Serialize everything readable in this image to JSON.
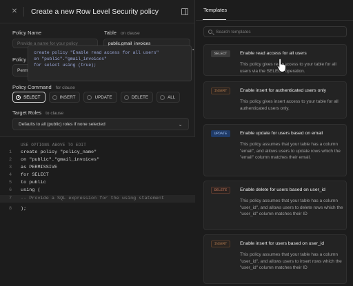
{
  "editor_panel": {
    "title": "Create a new Row Level Security policy",
    "policy_name_label": "Policy Name",
    "policy_name_placeholder": "Provide a name for your policy",
    "table_label": "Table",
    "table_sublabel": "on clause",
    "table_value": "public.gmail_invoices",
    "policy_behavior_label": "Policy B",
    "policy_behavior_value": "Perm",
    "tooltip_lines": [
      "create policy \"Enable read access for all users\"",
      "on \"public\".\"gmail_invoices\"",
      "for select using (true);"
    ],
    "policy_command_label": "Policy Command",
    "policy_command_sublabel": "for clause",
    "commands": [
      "SELECT",
      "INSERT",
      "UPDATE",
      "DELETE",
      "ALL"
    ],
    "selected_command": "SELECT",
    "target_roles_label": "Target Roles",
    "target_roles_sublabel": "to clause",
    "target_roles_value": "Defaults to all (public) roles if none selected",
    "code_lines": [
      {
        "n": "",
        "text": "USE OPTIONS ABOVE TO EDIT",
        "type": "comment"
      },
      {
        "n": "1",
        "text": "create policy \"policy_name\"",
        "type": "code"
      },
      {
        "n": "2",
        "text": "on \"public\".\"gmail_invoices\"",
        "type": "code"
      },
      {
        "n": "3",
        "text": "as PERMISSIVE",
        "type": "code"
      },
      {
        "n": "4",
        "text": "for SELECT",
        "type": "code"
      },
      {
        "n": "5",
        "text": "to public",
        "type": "code"
      },
      {
        "n": "6",
        "text": "using (",
        "type": "code"
      },
      {
        "n": "7",
        "text": "-- Provide a SQL expression for the using statement",
        "type": "comment"
      },
      {
        "n": "8",
        "text": ");",
        "type": "code"
      }
    ]
  },
  "templates_panel": {
    "tab_label": "Templates",
    "search_placeholder": "Search templates",
    "cards": [
      {
        "badge": "SELECT",
        "title": "Enable read access for all users",
        "description": "This policy gives read access to your table for all users via the SELECT operation."
      },
      {
        "badge": "INSERT",
        "title": "Enable insert for authenticated users only",
        "description": "This policy gives insert access to your table for all authenticated users only."
      },
      {
        "badge": "UPDATE",
        "title": "Enable update for users based on email",
        "description": "This policy assumes that your table has a column \"email\", and allows users to update rows which the \"email\" column matches their email."
      },
      {
        "badge": "DELETE",
        "title": "Enable delete for users based on user_id",
        "description": "This policy assumes that your table has a column \"user_id\", and allows users to delete rows which the \"user_id\" column matches their ID"
      },
      {
        "badge": "INSERT",
        "title": "Enable insert for users based on user_id",
        "description": "This policy assumes that your table has a column \"user_id\", and allows users to insert rows which the \"user_id\" column matches their ID"
      }
    ]
  },
  "colors": {
    "select_badge_bg": "#3a3a3a",
    "insert_badge_fg": "#b07a4e",
    "update_badge_bg": "#1f3a66",
    "delete_badge_fg": "#c97a5b"
  }
}
